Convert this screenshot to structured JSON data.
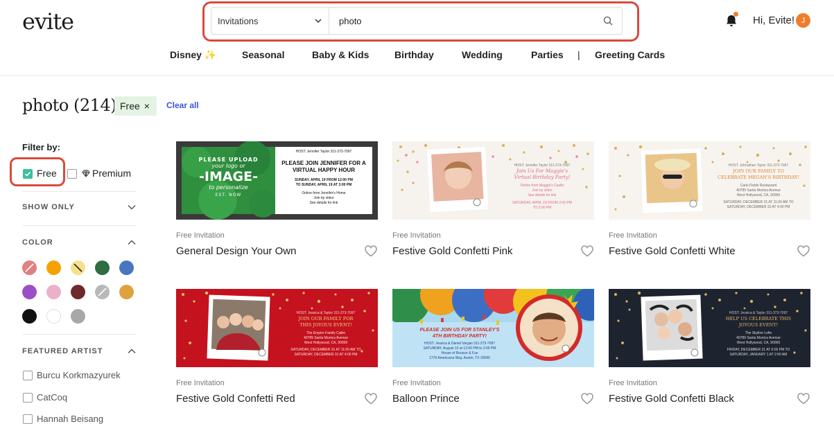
{
  "header": {
    "logo": "evite",
    "search": {
      "category": "Invitations",
      "query": "photo"
    },
    "greeting": "Hi, Evite!",
    "avatar_initial": "J",
    "accent": "#ef7e2c"
  },
  "nav": {
    "items": [
      "Disney ✨",
      "Seasonal",
      "Baby & Kids",
      "Birthday",
      "Wedding",
      "Parties",
      "Greeting Cards"
    ],
    "separator": "|"
  },
  "results": {
    "title": "photo (214)",
    "chip_label": "Free",
    "chip_close": "×",
    "clear_all": "Clear all"
  },
  "sidebar": {
    "filter_by": "Filter by:",
    "free_label": "Free",
    "premium_label": "Premium",
    "show_only": "SHOW ONLY",
    "color": "COLOR",
    "featured_artist": "FEATURED ARTIST",
    "artists": [
      "Burcu Korkmazyurek",
      "CatCoq",
      "Hannah Beisang"
    ],
    "swatches": [
      "#e08080",
      "#f5a200",
      "#f6e08a",
      "#2c6e3f",
      "#4a76c0",
      "#9b4fc6",
      "#eab1c8",
      "#6e2a2a",
      "#b8b8b8",
      "#e0a23d",
      "#111111",
      "#ffffff",
      "#a8a8a8"
    ]
  },
  "cards": [
    {
      "meta": "Free Invitation",
      "title": "General Design Your Own",
      "lines": [
        "PLEASE UPLOAD",
        "your logo or",
        "-IMAGE-",
        "to personalize",
        "EST. NOW"
      ],
      "host": "HOST: Jennifer Taylor 311-373-7097",
      "heading": [
        "PLEASE JOIN JENNIFER FOR A",
        "VIRTUAL HAPPY HOUR"
      ],
      "details": [
        "SUNDAY, APRIL 19 FROM 12:00 PM",
        "TO SUNDAY, APRIL 19 AT 3:00 PM"
      ],
      "extra": [
        "Online from Jennifer's Home",
        "Join by video",
        "See details for link"
      ]
    },
    {
      "meta": "Free Invitation",
      "title": "Festive Gold Confetti Pink",
      "host": "HOST: Jennifer Taylor 311-373-7097",
      "heading": [
        "Join Us For Maggie's",
        "Virtual Birthday Party!"
      ],
      "details": [
        "Online from Maggie's Castle",
        "Join by video",
        "See details for link",
        "SATURDAY, APRIL 18 FROM 2:00 PM",
        "TO 3:00 PM"
      ]
    },
    {
      "meta": "Free Invitation",
      "title": "Festive Gold Confetti White",
      "host": "HOST: Johnathan Taylor 311-373-7097",
      "heading": [
        "JOIN OUR FAMILY TO",
        "CELEBRATE MEGAN'S BIRTHDAY!"
      ],
      "details": [
        "Carlo Fields Restaurant",
        "40789 Santa Monica Avenue",
        "West Hollywood, CA, 90069",
        "SATURDAY, DECEMBER 31 AT 11:00 AM TO",
        "SATURDAY, DECEMBER 31 AT 4:00 PM"
      ]
    },
    {
      "meta": "Free Invitation",
      "title": "Festive Gold Confetti Red",
      "host": "HOST: Jessica & Taylor 311-373-7097",
      "heading": [
        "JOIN OUR FAMILY FOR",
        "THIS JOYOUS EVENT!"
      ],
      "details": [
        "The Empire Family Cabin",
        "40789 Santa Monica Avenue",
        "West Hollywood, CA, 90069",
        "SATURDAY, DECEMBER 31 AT 11:00 AM TO",
        "SATURDAY, DECEMBER 31 AT 4:00 PM"
      ]
    },
    {
      "meta": "Free Invitation",
      "title": "Balloon Prince",
      "heading": [
        "PLEASE JOIN US FOR STANLEY'S",
        "4TH BIRTHDAY PARTY!"
      ],
      "details": [
        "HOST: Jessica & Daniel Vargas 311-373-7097",
        "SATURDAY, August 10 at 12:00 PM to 2:00 PM",
        "House of Bounce & Fun",
        "1776 Americana Way, Austin, TX 20090"
      ]
    },
    {
      "meta": "Free Invitation",
      "title": "Festive Gold Confetti Black",
      "host": "HOST: Jessica & Taylor 311-373-7097",
      "heading": [
        "HELP US CELEBRATE THIS",
        "JOYOUS EVENT!"
      ],
      "details": [
        "The Skyline Lofts",
        "40789 Santa Monica Avenue",
        "West Hollywood, CA, 90069",
        "FRIDAY, DECEMBER 31 AT 6:00 PM TO",
        "SATURDAY, JANUARY 1 AT 2:00 AM"
      ]
    }
  ]
}
